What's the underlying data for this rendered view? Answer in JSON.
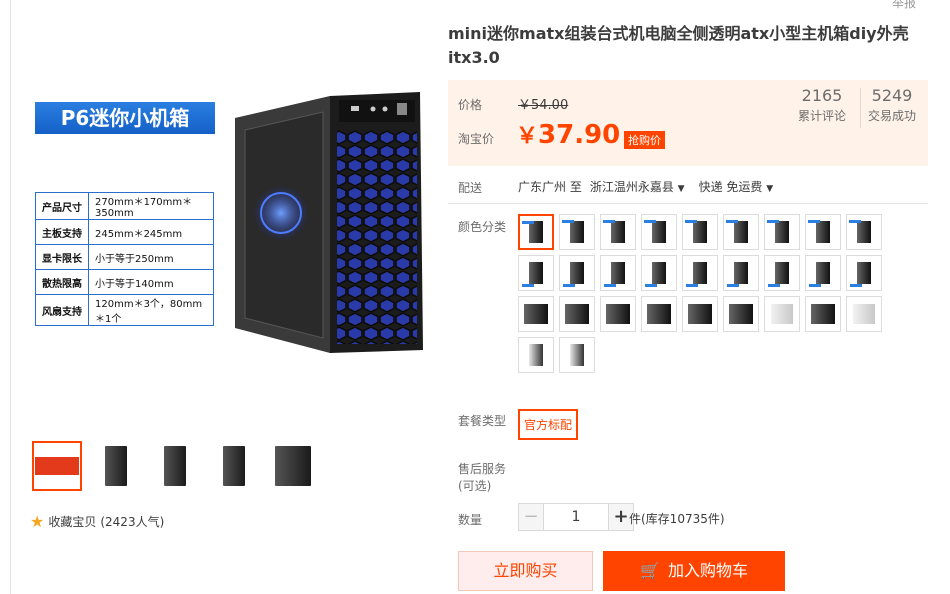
{
  "header": {
    "report_label": "举报"
  },
  "gallery": {
    "banner": "P6迷你小机箱",
    "specs": [
      {
        "k": "产品尺寸",
        "v": "270mm＊170mm＊350mm"
      },
      {
        "k": "主板支持",
        "v": "245mm＊245mm"
      },
      {
        "k": "显卡限长",
        "v": "小于等于250mm"
      },
      {
        "k": "散热限高",
        "v": "小于等于140mm"
      },
      {
        "k": "风扇支持",
        "v": "120mm＊3个，80mm＊1个"
      }
    ],
    "favorite_label": "收藏宝贝",
    "favorite_count": "(2423人气)"
  },
  "product": {
    "title": "mini迷你matx组装台式机电脑全侧透明atx小型主机箱diy外壳itx3.0",
    "price": {
      "label_price": "价格",
      "original": "￥54.00",
      "label_promo": "淘宝价",
      "currency": "￥",
      "current": "37.90",
      "promo_tag": "抢购价"
    },
    "stats": [
      {
        "num": "2165",
        "label": "累计评论"
      },
      {
        "num": "5249",
        "label": "交易成功"
      }
    ],
    "shipping": {
      "label": "配送",
      "from": "广东广州 至",
      "to": "浙江温州永嘉县",
      "method": "快递 免运费"
    },
    "color_label": "颜色分类",
    "package_label": "套餐类型",
    "package_option": "官方标配",
    "service_label": "售后服务",
    "service_note": "(可选)",
    "qty_label": "数量",
    "qty_value": "1",
    "stock_text": "件(库存10735件)",
    "buy_now": "立即购买",
    "add_cart": "加入购物车"
  },
  "colors": {
    "accent": "#ff4400",
    "price_bg": "#fff2e8",
    "spec_blue": "#2a6fcc"
  }
}
